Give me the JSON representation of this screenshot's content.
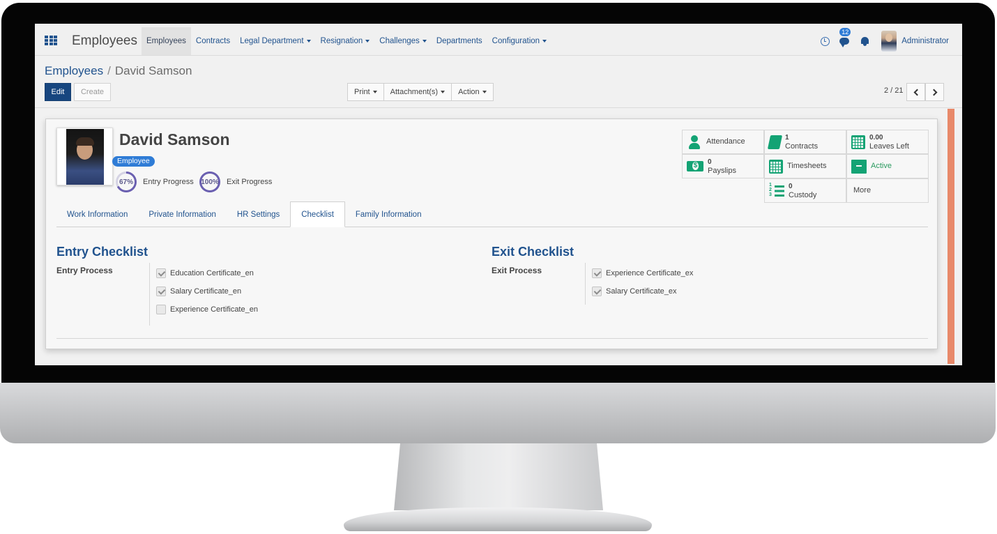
{
  "topbar": {
    "app_title": "Employees",
    "menu": [
      {
        "label": "Employees",
        "dropdown": false,
        "active": true
      },
      {
        "label": "Contracts",
        "dropdown": false
      },
      {
        "label": "Legal Department",
        "dropdown": true
      },
      {
        "label": "Resignation",
        "dropdown": true
      },
      {
        "label": "Challenges",
        "dropdown": true
      },
      {
        "label": "Departments",
        "dropdown": false
      },
      {
        "label": "Configuration",
        "dropdown": true
      }
    ],
    "messages_count": "12",
    "user_name": "Administrator"
  },
  "control_panel": {
    "breadcrumb_parent": "Employees",
    "breadcrumb_separator": "/",
    "breadcrumb_current": "David Samson",
    "edit_label": "Edit",
    "create_label": "Create",
    "print_label": "Print",
    "attachments_label": "Attachment(s)",
    "action_label": "Action",
    "pager": "2 / 21"
  },
  "employee": {
    "name": "David Samson",
    "badge": "Employee",
    "entry_progress_value": "67%",
    "entry_progress_label": "Entry Progress",
    "exit_progress_value": "100%",
    "exit_progress_label": "Exit Progress"
  },
  "stats": {
    "attendance": "Attendance",
    "contracts_count": "1",
    "contracts": "Contracts",
    "leaves_count": "0.00",
    "leaves": "Leaves Left",
    "payslips_count": "0",
    "payslips": "Payslips",
    "timesheets": "Timesheets",
    "active": "Active",
    "custody_count": "0",
    "custody": "Custody",
    "more": "More"
  },
  "tabs": [
    {
      "label": "Work Information"
    },
    {
      "label": "Private Information"
    },
    {
      "label": "HR Settings"
    },
    {
      "label": "Checklist",
      "active": true
    },
    {
      "label": "Family Information"
    }
  ],
  "entry_checklist": {
    "title": "Entry Checklist",
    "label": "Entry Process",
    "items": [
      {
        "label": "Education Certificate_en",
        "checked": true
      },
      {
        "label": "Salary Certificate_en",
        "checked": true
      },
      {
        "label": "Experience Certificate_en",
        "checked": false
      }
    ]
  },
  "exit_checklist": {
    "title": "Exit Checklist",
    "label": "Exit Process",
    "items": [
      {
        "label": "Experience Certificate_ex",
        "checked": true
      },
      {
        "label": "Salary Certificate_ex",
        "checked": true
      }
    ]
  },
  "colors": {
    "primary": "#21538e",
    "edit_button": "#17467f",
    "badge": "#2f7cd6",
    "stat_icon": "#13a374",
    "status_stripe": "#e8896a"
  }
}
